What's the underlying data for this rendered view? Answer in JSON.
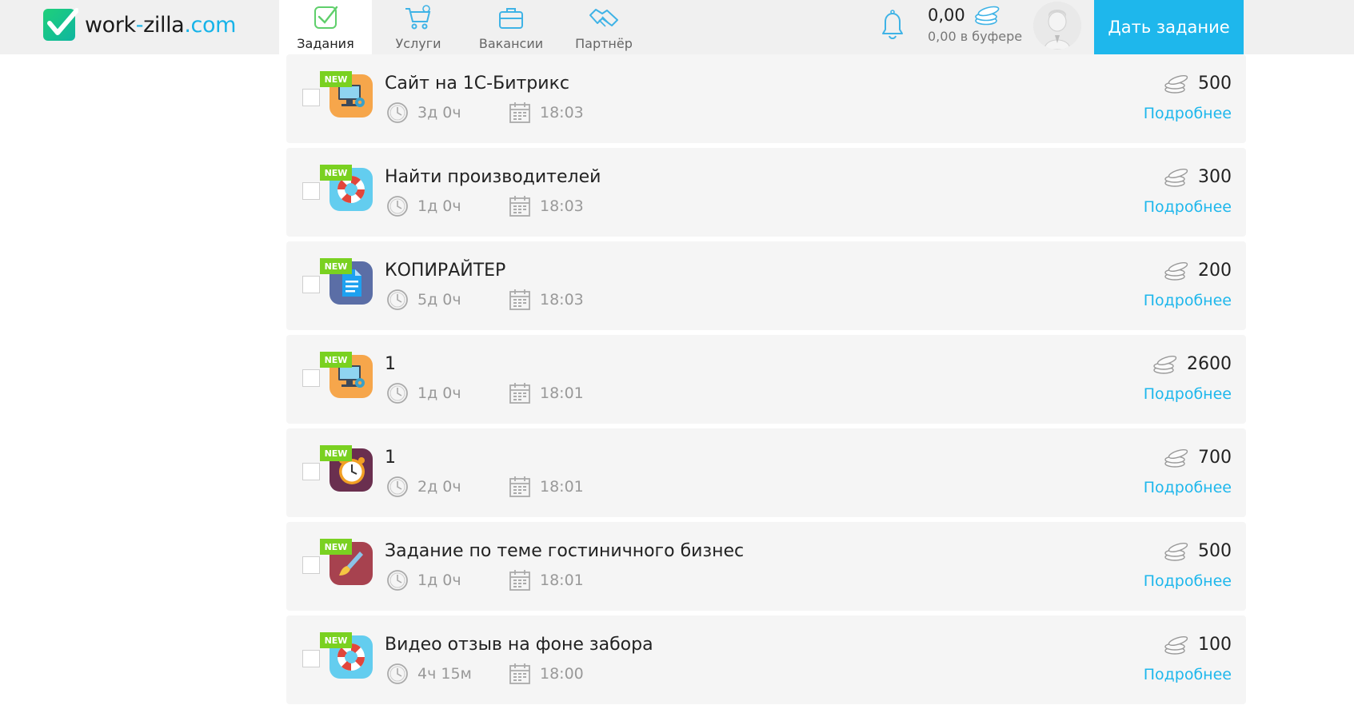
{
  "header": {
    "logo": {
      "name": "work",
      "dash": "-",
      "name2": "zilla",
      "tld": ".com"
    },
    "nav": [
      {
        "label": "Задания",
        "icon": "tasks-check-icon",
        "active": true
      },
      {
        "label": "Услуги",
        "icon": "cart-icon",
        "active": false
      },
      {
        "label": "Вакансии",
        "icon": "briefcase-icon",
        "active": false
      },
      {
        "label": "Партнёр",
        "icon": "handshake-icon",
        "active": false
      }
    ],
    "balance": {
      "amount": "0,00",
      "buffer": "0,00 в буфере"
    },
    "give_task_label": "Дать задание"
  },
  "colors": {
    "accent": "#1eb7ec",
    "new_badge": "#7ad121",
    "logo_green": "#2fd158"
  },
  "tasks": [
    {
      "badge": "NEW",
      "category_icon": "computer-gear-icon",
      "icon_bg": "#f6a64b",
      "title": "Сайт на 1С-Битрикс",
      "duration": "3д 0ч",
      "time": "18:03",
      "price": "500",
      "more": "Подробнее"
    },
    {
      "badge": "NEW",
      "category_icon": "lifebuoy-icon",
      "icon_bg": "#63cdef",
      "title": "Найти производителей",
      "duration": "1д 0ч",
      "time": "18:03",
      "price": "300",
      "more": "Подробнее"
    },
    {
      "badge": "NEW",
      "category_icon": "document-icon",
      "icon_bg": "#5b6ea6",
      "title": "КОПИРАЙТЕР",
      "duration": "5д 0ч",
      "time": "18:03",
      "price": "200",
      "more": "Подробнее"
    },
    {
      "badge": "NEW",
      "category_icon": "computer-gear-icon",
      "icon_bg": "#f6a64b",
      "title": "1",
      "duration": "1д 0ч",
      "time": "18:01",
      "price": "2600",
      "more": "Подробнее"
    },
    {
      "badge": "NEW",
      "category_icon": "alarm-clock-icon",
      "icon_bg": "#6a2f4f",
      "title": "1",
      "duration": "2д 0ч",
      "time": "18:01",
      "price": "700",
      "more": "Подробнее"
    },
    {
      "badge": "NEW",
      "category_icon": "paintbrush-icon",
      "icon_bg": "#a7424f",
      "title": "Задание по теме гостиничного бизнес",
      "duration": "1д 0ч",
      "time": "18:01",
      "price": "500",
      "more": "Подробнее"
    },
    {
      "badge": "NEW",
      "category_icon": "lifebuoy-icon",
      "icon_bg": "#63cdef",
      "title": "Видео отзыв на фоне забора",
      "duration": "4ч 15м",
      "time": "18:00",
      "price": "100",
      "more": "Подробнее"
    }
  ]
}
